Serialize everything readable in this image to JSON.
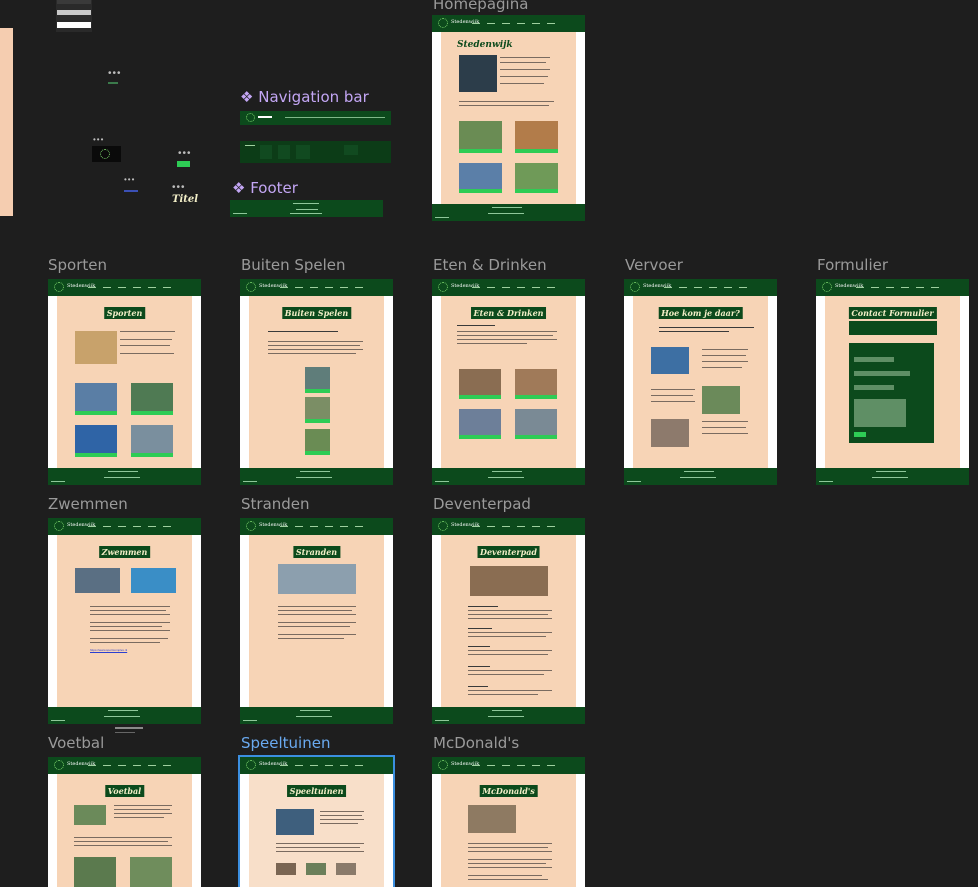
{
  "canvas": {
    "background": "#1e1e1e"
  },
  "components": {
    "navigation_bar": "Navigation bar",
    "footer": "Footer",
    "title_sample": "Titel"
  },
  "frames": {
    "homepagina": {
      "label": "Homepagina",
      "title": "Stedenwijk",
      "buttons": [
        "Sporten",
        "Eten & Drinken",
        "Buiten Spelen",
        "Hoe kom je daar?"
      ]
    },
    "sporten": {
      "label": "Sporten",
      "title": "Sporten",
      "buttons": [
        "Zwemmen",
        "Voetbal",
        "Stranden",
        "Tennis",
        "Buiten Fitness"
      ]
    },
    "buiten_spelen": {
      "label": "Buiten Spelen",
      "title": "Buiten Spelen",
      "buttons": [
        "Deventerpad",
        "Speeltuinen"
      ]
    },
    "eten_drinken": {
      "label": "Eten & Drinken",
      "title": "Eten & Drinken",
      "buttons": [
        "McDonald's",
        "Pizzeria",
        "Sushi",
        "Frietzaak"
      ]
    },
    "vervoer": {
      "label": "Vervoer",
      "title": "Hoe kom je daar?"
    },
    "formulier": {
      "label": "Formulier",
      "title": "Contact Formulier"
    },
    "zwemmen": {
      "label": "Zwemmen",
      "title": "Zwemmen",
      "link": "https://www.sportcomplex.nl"
    },
    "stranden": {
      "label": "Stranden",
      "title": "Stranden"
    },
    "deventerpad": {
      "label": "Deventerpad",
      "title": "Deventerpad"
    },
    "voetbal": {
      "label": "Voetbal",
      "title": "Voetbal"
    },
    "speeltuinen": {
      "label": "Speeltuinen",
      "title": "Speeltuinen"
    },
    "mcdonalds": {
      "label": "McDonald's",
      "title": "McDonald's"
    }
  },
  "colors": {
    "nav_green": "#0c4a1c",
    "peach": "#f7d4b6",
    "button_green": "#2ecc55",
    "selection": "#3b8fe0"
  }
}
